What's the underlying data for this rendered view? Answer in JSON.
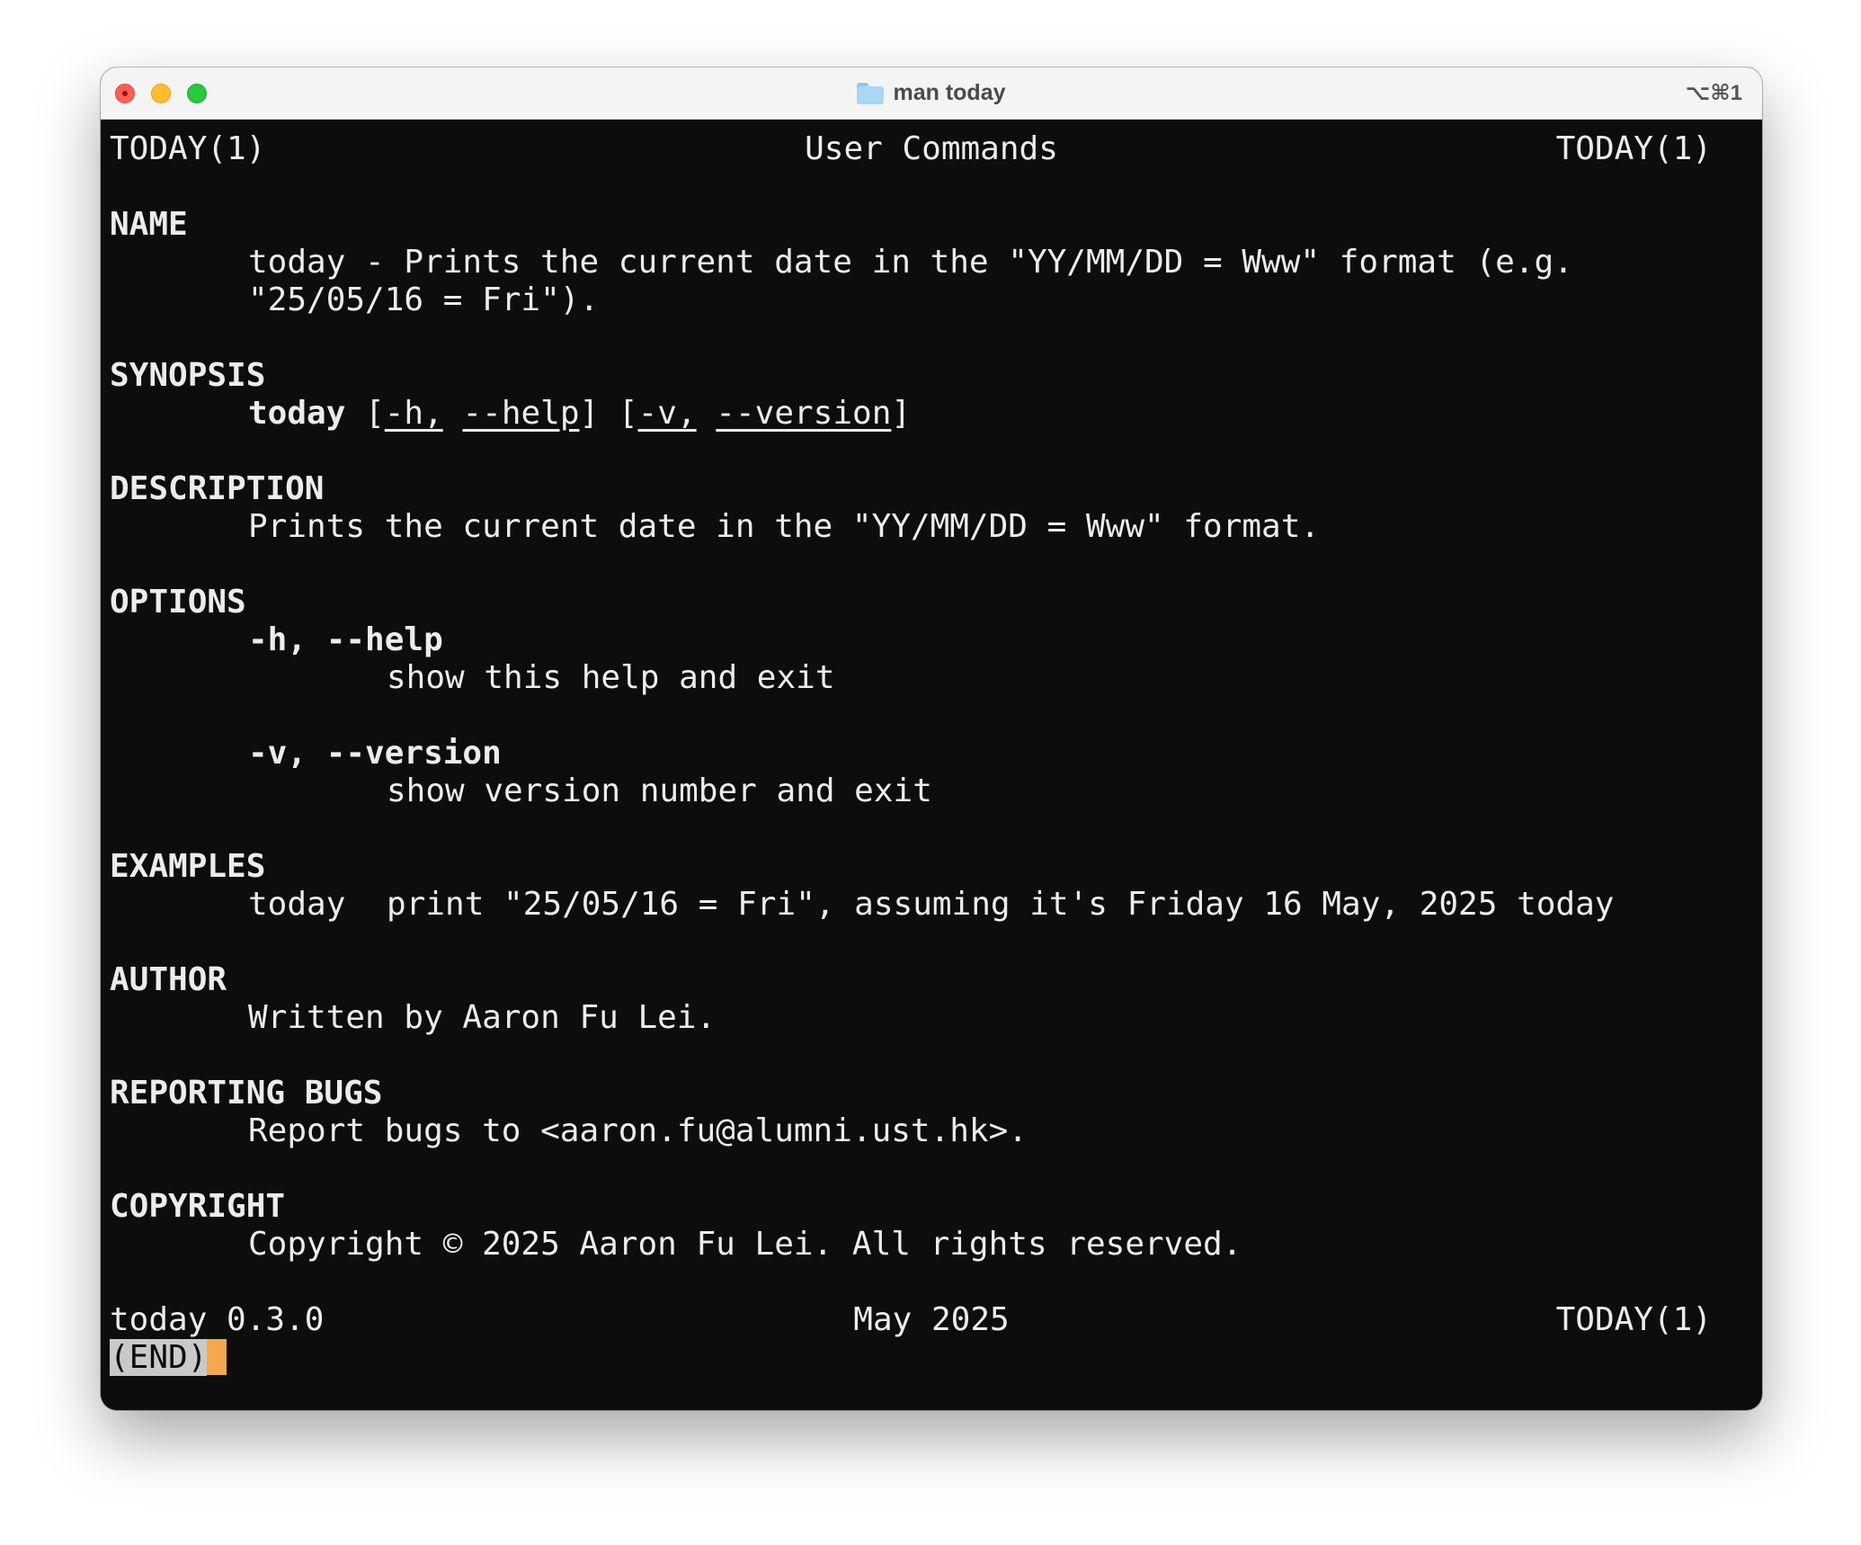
{
  "window": {
    "title": "man today",
    "shortcut": "⌥⌘1"
  },
  "header": {
    "left": "TODAY(1)",
    "center": "User Commands",
    "right": "TODAY(1)"
  },
  "name": {
    "heading": "NAME",
    "line1": "today - Prints the current date in the \"YY/MM/DD = Www\" format (e.g.",
    "line2": "\"25/05/16 = Fri\")."
  },
  "synopsis": {
    "heading": "SYNOPSIS",
    "command": "today",
    "open1": "[",
    "opt_h": "-h,",
    "opt_help": "--help",
    "close1": "]",
    "open2": "[",
    "opt_v": "-v,",
    "opt_version": "--version",
    "close2": "]"
  },
  "description": {
    "heading": "DESCRIPTION",
    "text": "Prints the current date in the \"YY/MM/DD = Www\" format."
  },
  "options": {
    "heading": "OPTIONS",
    "items": [
      {
        "flag": "-h, --help",
        "desc": "show this help and exit"
      },
      {
        "flag": "-v, --version",
        "desc": "show version number and exit"
      }
    ]
  },
  "examples": {
    "heading": "EXAMPLES",
    "command": "today",
    "text": "print \"25/05/16 = Fri\", assuming it's Friday 16 May, 2025 today"
  },
  "author": {
    "heading": "AUTHOR",
    "text": "Written by Aaron Fu Lei."
  },
  "reporting_bugs": {
    "heading": "REPORTING BUGS",
    "text": "Report bugs to <aaron.fu@alumni.ust.hk>."
  },
  "copyright": {
    "heading": "COPYRIGHT",
    "text": "Copyright © 2025 Aaron Fu Lei. All rights reserved."
  },
  "footer": {
    "left": "today 0.3.0",
    "center": "May 2025",
    "right": "TODAY(1)"
  },
  "pager": {
    "status": "(END)"
  },
  "colors": {
    "background": "#0d0d0d",
    "foreground": "#ececec",
    "cursor": "#f5a84b",
    "close": "#ff5f57",
    "minimize": "#febc2e",
    "maximize": "#28c840"
  }
}
